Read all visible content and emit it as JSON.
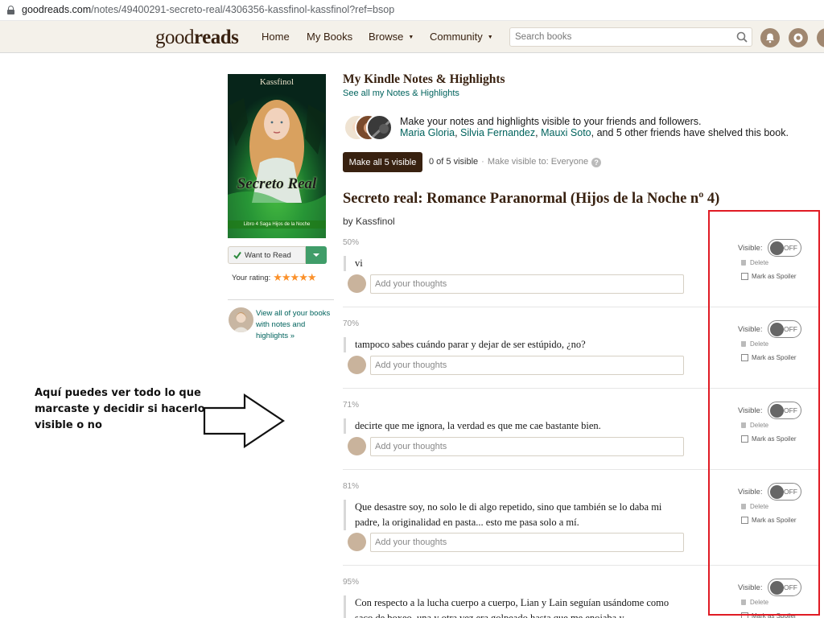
{
  "browser": {
    "url_domain": "goodreads.com",
    "url_path": "/notes/49400291-secreto-real/4306356-kassfinol-kassfinol?ref=bsop"
  },
  "header": {
    "logo_light": "good",
    "logo_bold": "reads",
    "nav": [
      {
        "label": "Home"
      },
      {
        "label": "My Books"
      },
      {
        "label": "Browse"
      },
      {
        "label": "Community"
      }
    ],
    "search_placeholder": "Search books"
  },
  "cover": {
    "top_text": "Kassfinol",
    "title": "Secreto Real",
    "subtitle": "Libro 4 Saga Hijos de la Noche"
  },
  "shelf": {
    "status_label": "Want to Read",
    "rating_label": "Your rating:",
    "stars": "★★★★★",
    "view_all": "View all of your books with notes and highlights »"
  },
  "annotation": {
    "text": "Aquí puedes ver todo lo que marcaste y decidir si hacerlo visible o no"
  },
  "main": {
    "heading": "My Kindle Notes & Highlights",
    "see_all": "See all my Notes & Highlights",
    "visibility_message": "Make your notes and highlights visible to your friends and followers.",
    "friend_1": "Maria Gloria",
    "friend_2": "Silvia Fernandez",
    "friend_3": "Mauxi Soto",
    "friends_suffix": ", and 5 other friends have shelved this book.",
    "make_all_button": "Make all 5 visible",
    "visible_count": "0 of 5 visible",
    "make_visible_to": "Make visible to: Everyone",
    "book_title": "Secreto real: Romance Paranormal (Hijos de la Noche nº 4)",
    "byline": "by Kassfinol"
  },
  "highlight_controls": {
    "visible_label": "Visible:",
    "toggle_label": "OFF",
    "delete_label": "Delete",
    "spoiler_label": "Mark as Spoiler",
    "thoughts_placeholder": "Add your thoughts"
  },
  "highlights": [
    {
      "percent": "50%",
      "text": "vi"
    },
    {
      "percent": "70%",
      "text": "tampoco sabes cuándo parar y dejar de ser estúpido, ¿no?"
    },
    {
      "percent": "71%",
      "text": "decirte que me ignora, la verdad es que me cae bastante bien."
    },
    {
      "percent": "81%",
      "text": "Que desastre soy, no solo le di algo repetido, sino que también se lo daba mi padre, la originalidad en pasta... esto me pasa solo a mí."
    },
    {
      "percent": "95%",
      "text": "Con respecto a la lucha cuerpo a cuerpo, Lian y Lain seguían usándome como saco de boxeo, una y otra vez era golpeado hasta que me enojaba y"
    }
  ],
  "colors": {
    "header_bg": "#f4f1ea",
    "brand_brown": "#382110",
    "link_teal": "#00635d",
    "wtr_green": "#409d69",
    "star_orange": "#fb912b",
    "annotation_red": "#e01b24"
  }
}
